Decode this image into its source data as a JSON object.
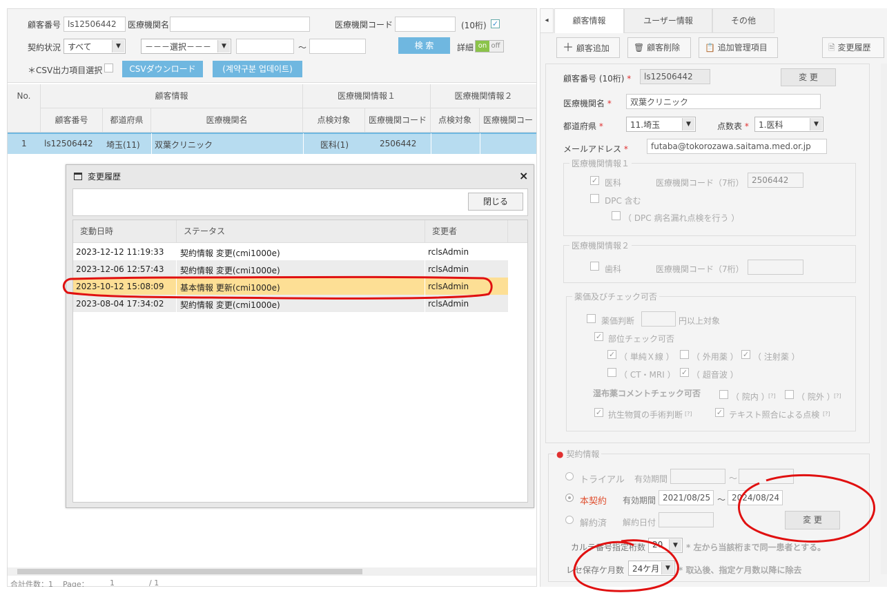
{
  "search": {
    "customer_no_label": "顧客番号",
    "customer_no_value": "ls12506442",
    "facility_name_label": "医療機関名",
    "facility_name_value": "",
    "facility_code_label": "医療機関コード",
    "facility_code_value": "",
    "digits_label": "(10桁)",
    "contract_status_label": "契約状況",
    "contract_status_value": "すべて",
    "select_placeholder": "－－－選択－－－",
    "range_sep": "～",
    "search_button": "検 索",
    "detail_label": "詳細",
    "toggle_on": "on",
    "toggle_off": "off",
    "csv_items_label": "＊CSV出力項目選択",
    "csv_download_button": "CSVダウンロード",
    "contract_update_button": "(계약구분 업데이트)"
  },
  "table": {
    "col_no": "No.",
    "group_customer": "顧客情報",
    "group_fac1": "医療機関情報１",
    "group_fac2": "医療機関情報２",
    "sub_customer_no": "顧客番号",
    "sub_prefecture": "都道府県",
    "sub_facility_name": "医療機関名",
    "sub_check_target1": "点検対象",
    "sub_facility_code1": "医療機関コード",
    "sub_check_target2": "点検対象",
    "sub_facility_code2": "医療機関コー",
    "rows": [
      {
        "no": "1",
        "customer_no": "ls12506442",
        "prefecture": "埼玉(11)",
        "facility_name": "双葉クリニック",
        "check_target": "医科(1)",
        "facility_code": "2506442"
      }
    ]
  },
  "footer": {
    "total_label": "合計件数：1",
    "page_label": "Page：",
    "page_value": "1",
    "page_of": "/ 1"
  },
  "dialog": {
    "title": "変更履歴",
    "close_x": "×",
    "close_button": "閉じる",
    "col_datetime": "変動日時",
    "col_status": "ステータス",
    "col_changer": "変更者",
    "rows": [
      {
        "datetime": "2023-12-12 11:19:33",
        "status": "契約情報 変更(cmi1000e)",
        "changer": "rclsAdmin"
      },
      {
        "datetime": "2023-12-06 12:57:43",
        "status": "契約情報 変更(cmi1000e)",
        "changer": "rclsAdmin"
      },
      {
        "datetime": "2023-10-12 15:08:09",
        "status": "基本情報 更新(cmi1000e)",
        "changer": "rclsAdmin"
      },
      {
        "datetime": "2023-08-04 17:34:02",
        "status": "契約情報 変更(cmi1000e)",
        "changer": "rclsAdmin"
      }
    ],
    "selected_row": 2,
    "selected_color": "#fddf95"
  },
  "right": {
    "collapse_arrow": "◂",
    "tabs": [
      "顧客情報",
      "ユーザー情報",
      "その他"
    ],
    "toolbar": {
      "add_customer": "顧客追加",
      "delete_customer": "顧客削除",
      "add_mgmt_item": "追加管理項目",
      "change_history": "変更履歴"
    },
    "form": {
      "customer_no_label": "顧客番号 (10桁)",
      "customer_no_value": "ls12506442",
      "change_button": "変 更",
      "facility_name_label": "医療機関名",
      "facility_name_value": "双葉クリニック",
      "prefecture_label": "都道府県",
      "prefecture_value": "11.埼玉",
      "score_table_label": "点数表",
      "score_table_value": "1.医科",
      "email_label": "メールアドレス",
      "email_value": "futaba@tokorozawa.saitama.med.or.jp",
      "required_mark": "*"
    },
    "fac1": {
      "legend": "医療機関情報１",
      "medical": "医科",
      "code_label": "医療機関コード（7桁）",
      "code_value": "2506442",
      "dpc": "DPC 含む",
      "dpc_sub": "（ DPC 病名漏れ点検を行う ）"
    },
    "fac2": {
      "legend": "医療機関情報２",
      "dental": "歯科",
      "code_label": "医療機関コード（7桁）"
    },
    "drug": {
      "legend": "薬価及びチェック可否",
      "drug_price": "薬価判断",
      "yen_label": "円以上対象",
      "site_check": "部位チェック可否",
      "xray": "（ 単純Ｘ線 ）",
      "external": "（ 外用薬 ）",
      "injection": "（ 注射薬 ）",
      "ctmri": "（ CT・MRI ）",
      "ultrasound": "（ 超音波 ）",
      "poultice": "湿布薬コメントチェック可否",
      "inhospital": "（ 院内 ）",
      "outhospital": "（ 院外 ）",
      "help": "[?]",
      "antibiotic": "抗生物質の手術判断",
      "text_check": "テキスト照合による点検"
    },
    "contract": {
      "legend": "契約情報",
      "trial": "トライアル",
      "valid_period": "有効期間",
      "full_contract": "本契約",
      "start_date": "2021/08/25",
      "range_sep": "～",
      "end_date": "2024/08/24",
      "cancelled": "解約済",
      "cancel_date_label": "解約日付",
      "change_button": "変 更",
      "karte_digits_label": "カルテ番号指定桁数",
      "karte_digits_value": "20",
      "karte_note": "* 左から当該桁まで同一患者とする。",
      "rezept_label": "レセ保存ケ月数",
      "rezept_value": "24ケ月",
      "rezept_note": "* 取込後、指定ケ月数以降に除去"
    }
  }
}
